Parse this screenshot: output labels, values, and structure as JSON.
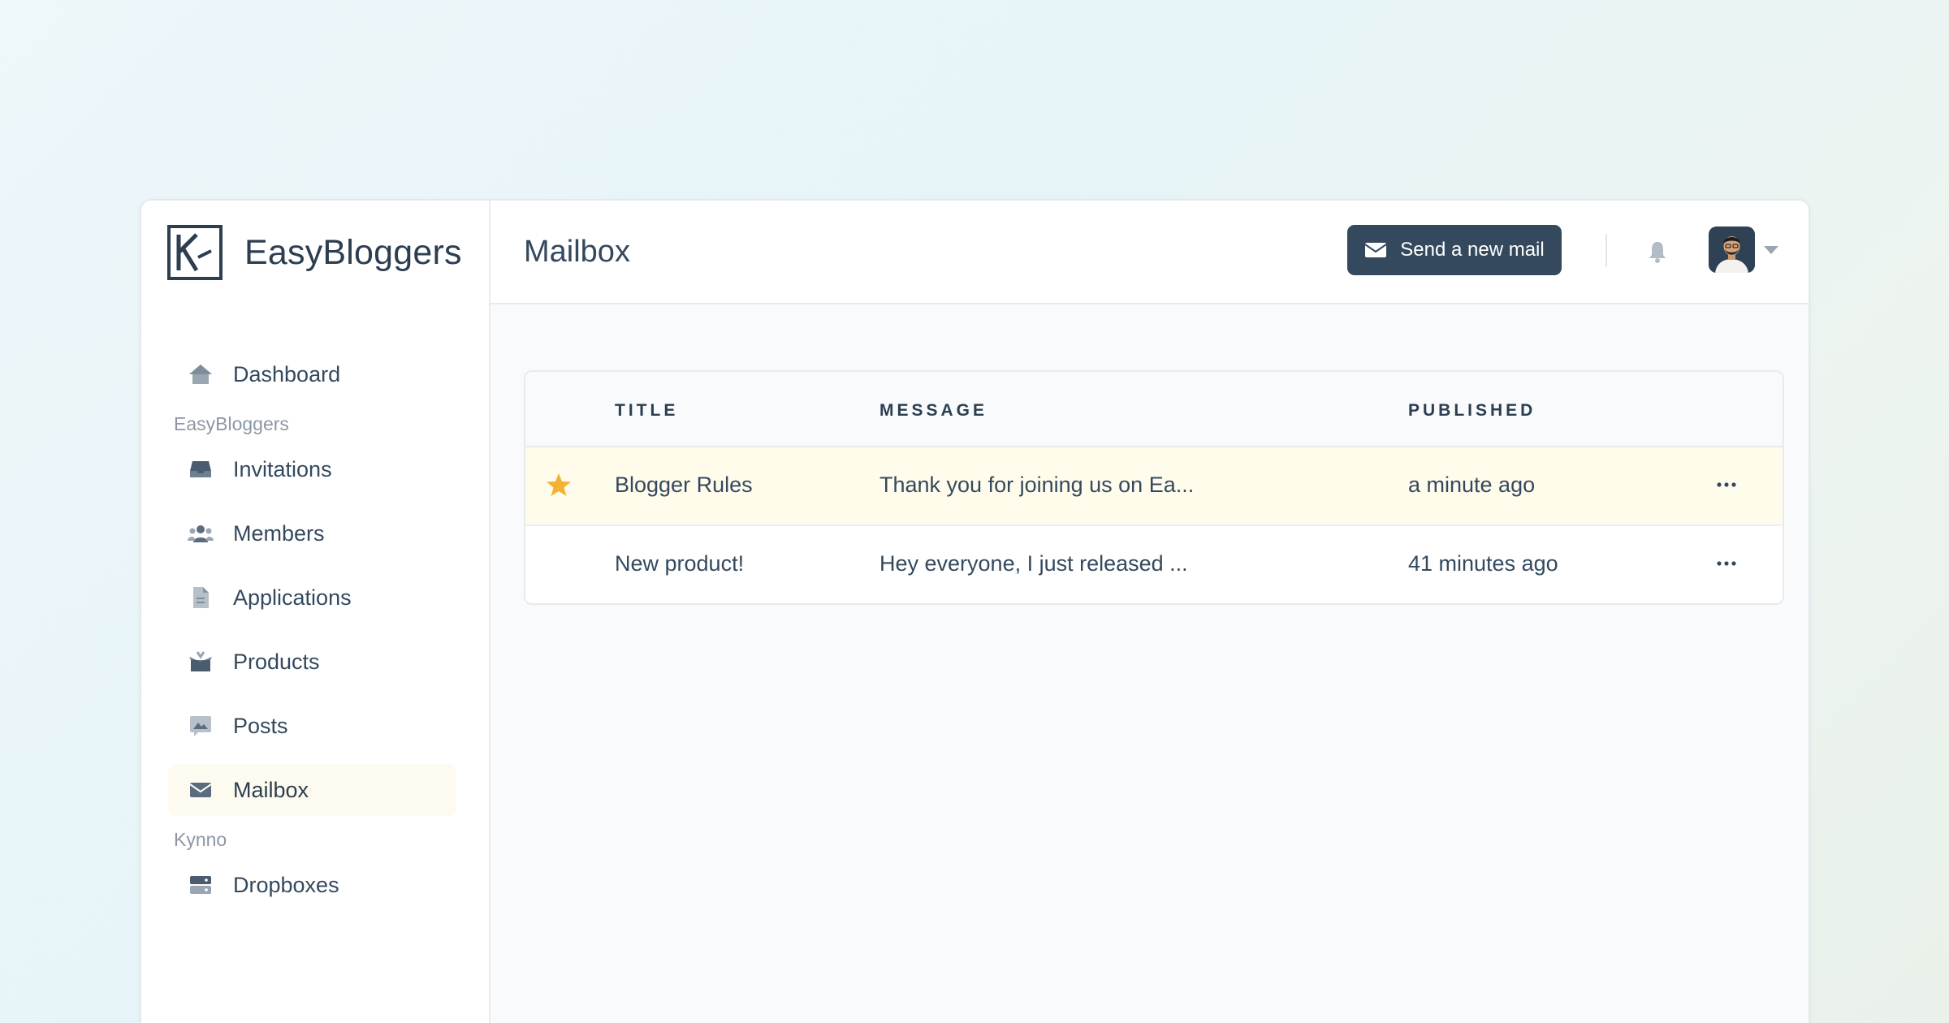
{
  "brand": {
    "name": "EasyBloggers"
  },
  "sidebar": {
    "dashboard": {
      "label": "Dashboard",
      "icon": "home-icon"
    },
    "sections": [
      {
        "title": "EasyBloggers",
        "items": [
          {
            "label": "Invitations",
            "icon": "inbox-icon"
          },
          {
            "label": "Members",
            "icon": "users-icon"
          },
          {
            "label": "Applications",
            "icon": "document-icon"
          },
          {
            "label": "Products",
            "icon": "box-icon"
          },
          {
            "label": "Posts",
            "icon": "image-chat-icon"
          },
          {
            "label": "Mailbox",
            "icon": "envelope-icon",
            "active": true
          }
        ]
      },
      {
        "title": "Kynno",
        "items": [
          {
            "label": "Dropboxes",
            "icon": "server-icon"
          }
        ]
      }
    ]
  },
  "header": {
    "title": "Mailbox",
    "send_button_label": "Send a new mail"
  },
  "table": {
    "columns": [
      "TITLE",
      "MESSAGE",
      "PUBLISHED"
    ],
    "rows": [
      {
        "title": "Blogger Rules",
        "message": "Thank you for joining us on Ea...",
        "published": "a minute ago",
        "starred": true
      },
      {
        "title": "New product!",
        "message": "Hey everyone, I just released ...",
        "published": "41 minutes ago",
        "starred": false
      }
    ]
  },
  "colors": {
    "primary": "#34495e",
    "star": "#f2b233",
    "starred_row": "#fffcec",
    "active_nav": "#fdfbf0"
  }
}
